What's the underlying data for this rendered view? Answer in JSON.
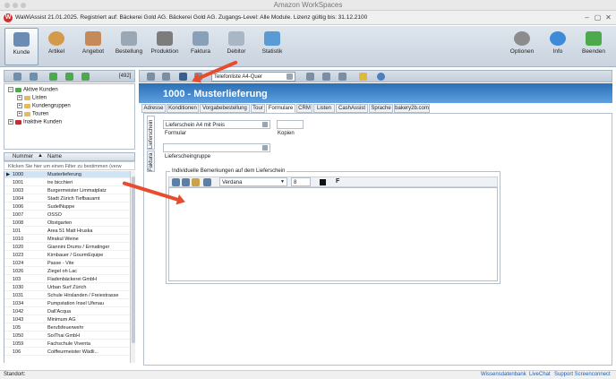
{
  "workspace": {
    "title": "Amazon WorkSpaces"
  },
  "app": {
    "title": "WaWiAssist 21.01.2025.  Registriert auf: Bäckerei Gold AG. Bäckerei Gold AG.  Zugangs-Level: Alle Module.  Lizenz gültig bis: 31.12.2100",
    "logo": "W"
  },
  "ribbon": {
    "left": [
      "Kunde",
      "Artikel",
      "Angebot",
      "Bestellung",
      "Produktion",
      "Faktura",
      "Debitor",
      "Statistik"
    ],
    "right": [
      "Optionen",
      "Info",
      "Beenden"
    ]
  },
  "left_toolbar": {
    "count": "[492]"
  },
  "tree": {
    "root": "Aktive Kunden",
    "children": [
      "Listen",
      "Kundengruppen",
      "Touren"
    ],
    "other": "Inaktive Kunden"
  },
  "list": {
    "headers": [
      "Nummer",
      "Name"
    ],
    "filter_placeholder": "Klicken Sie hier um einen Filter zu bestimmen (verw",
    "rows": [
      [
        "1000",
        "Musterlieferung"
      ],
      [
        "1001",
        "tre bicchieri"
      ],
      [
        "1003",
        "Burgermeister Limmatplatz"
      ],
      [
        "1004",
        "Stadt Zürich Tiefbauamt"
      ],
      [
        "1006",
        "SudelNuppe"
      ],
      [
        "1007",
        "OSSO"
      ],
      [
        "1008",
        "Obstgarten"
      ],
      [
        "101",
        "Area 51 Matt Hruska"
      ],
      [
        "1010",
        "Mirakul Weine"
      ],
      [
        "1020",
        "Giannini Drums / Ermatinger"
      ],
      [
        "1023",
        "Kirnbauer / GourmEquipe"
      ],
      [
        "1024",
        "Passe - Vite"
      ],
      [
        "1026",
        "Ziegel oh Lac"
      ],
      [
        "103",
        "Fladenbäckerei GmbH"
      ],
      [
        "1030",
        "Urban Surf Zürich"
      ],
      [
        "1031",
        "Schule Hirslanden / Freiestrasse"
      ],
      [
        "1034",
        "Pumpstation Insel Ufenau"
      ],
      [
        "1042",
        "Dall'Acqua"
      ],
      [
        "1043",
        "Minimum AG"
      ],
      [
        "105",
        "Berufsfeuerwehr"
      ],
      [
        "1050",
        "SoiThai GmbH"
      ],
      [
        "1059",
        "Fachschule Viventa"
      ],
      [
        "106",
        "Coiffeurmeister Wädli..."
      ]
    ]
  },
  "toolbar": {
    "print_combo": "Telefonliste A4-Quer"
  },
  "header": {
    "title": "1000 - Musterlieferung"
  },
  "tabs": [
    "Adresse",
    "Konditionen",
    "Vorgabebestellung",
    "Tour",
    "Formulare",
    "CRM",
    "Listen",
    "CashAssist",
    "Sprache",
    "bakery2b.com"
  ],
  "active_tab": "Formulare",
  "vtabs": [
    "Lieferschein",
    "Faktura"
  ],
  "form": {
    "formular_value": "Lieferschein A4 mit Preis",
    "formular_label": "Formular",
    "kopien_value": "",
    "kopien_label": "Kopien",
    "gruppe_value": "",
    "gruppe_label": "Lieferscheingruppe"
  },
  "group": {
    "title": "Individuelle Bemerkungen auf dem Lieferschein"
  },
  "editor": {
    "font": "Verdana",
    "size": "8",
    "bold": "F",
    "text": ""
  },
  "status": {
    "left": "Standort:",
    "links": [
      "Wissensdatenbank",
      "LiveChat",
      "Support Screenconnect"
    ]
  },
  "colors": {
    "header_band": "#2b6fb5",
    "selection": "#cfe5f7",
    "annotation_arrow": "#e94c2c",
    "title_logo": "#d32b2b"
  }
}
